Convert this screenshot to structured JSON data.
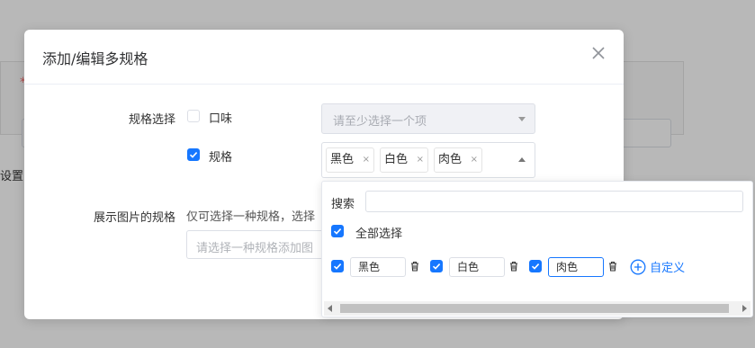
{
  "background": {
    "required_mark": "*",
    "partial_text": "设置多"
  },
  "dialog": {
    "title": "添加/编辑多规格",
    "spec_select_label": "规格选择",
    "options": [
      {
        "label": "口味",
        "checked": false
      },
      {
        "label": "规格",
        "checked": true
      }
    ],
    "flavor_select_placeholder": "请至少选择一个项",
    "selected_tags": [
      "黑色",
      "白色",
      "肉色"
    ],
    "tag_remove": "×",
    "image_spec_label": "展示图片的规格",
    "image_spec_hint": "仅可选择一种规格，选择",
    "image_spec_placeholder": "请选择一种规格添加图"
  },
  "dropdown": {
    "search_label": "搜索",
    "search_value": "",
    "select_all_label": "全部选择",
    "select_all_checked": true,
    "items": [
      {
        "value": "黑色",
        "checked": true
      },
      {
        "value": "白色",
        "checked": true
      },
      {
        "value": "肉色",
        "checked": true
      }
    ],
    "custom_label": "自定义"
  },
  "colors": {
    "accent": "#1677ff",
    "overlay": "rgba(0,0,0,0.28)"
  }
}
